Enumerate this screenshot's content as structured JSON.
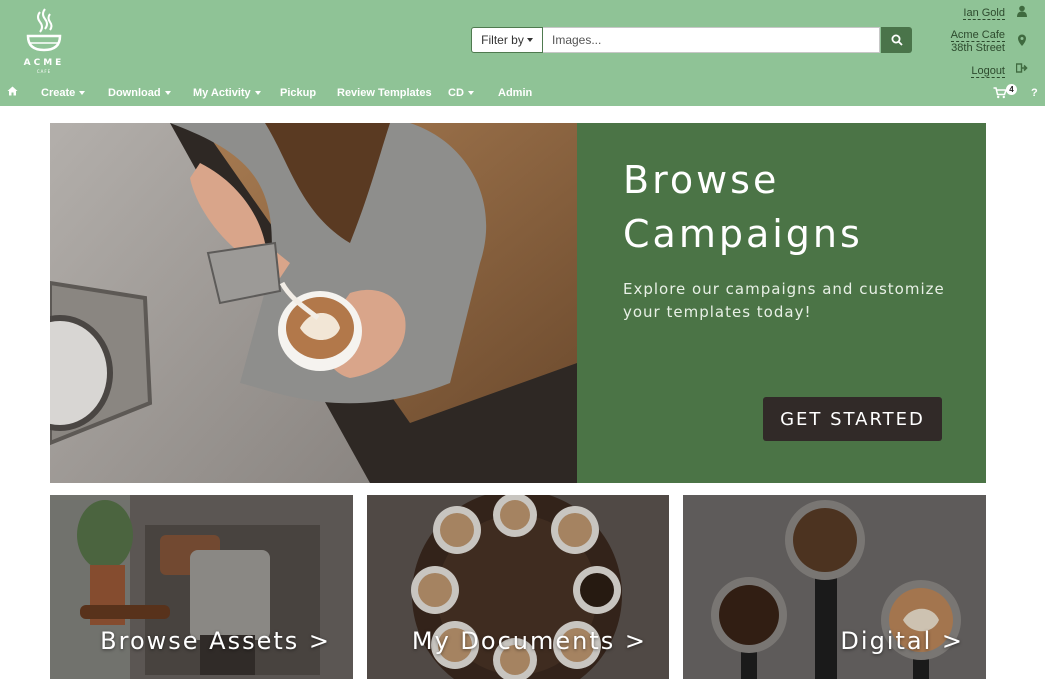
{
  "brand": {
    "logo_text": "ACME",
    "logo_sub": "CAFE",
    "accent": "#8fc396",
    "dark_green": "#4b7446"
  },
  "search": {
    "filter_label": "Filter by",
    "placeholder": "Images...",
    "button_icon": "search-icon"
  },
  "user": {
    "name": "Ian Gold",
    "location_line1": "Acme Cafe",
    "location_line2": "38th Street",
    "logout": "Logout"
  },
  "nav": {
    "items": [
      {
        "label": "Create"
      },
      {
        "label": "Download"
      },
      {
        "label": "My Activity"
      },
      {
        "label": "Pickup"
      },
      {
        "label": "Review Templates"
      },
      {
        "label": "CD"
      },
      {
        "label": "Admin"
      }
    ],
    "cart_count": "4",
    "help": "?"
  },
  "hero": {
    "title_line1": "Browse",
    "title_line2": "Campaigns",
    "subtitle": "Explore our campaigns and customize your templates today!",
    "cta": "GET STARTED"
  },
  "tiles": [
    {
      "label": "Browse Assets >"
    },
    {
      "label": "My Documents >"
    },
    {
      "label": "Digital >"
    }
  ]
}
